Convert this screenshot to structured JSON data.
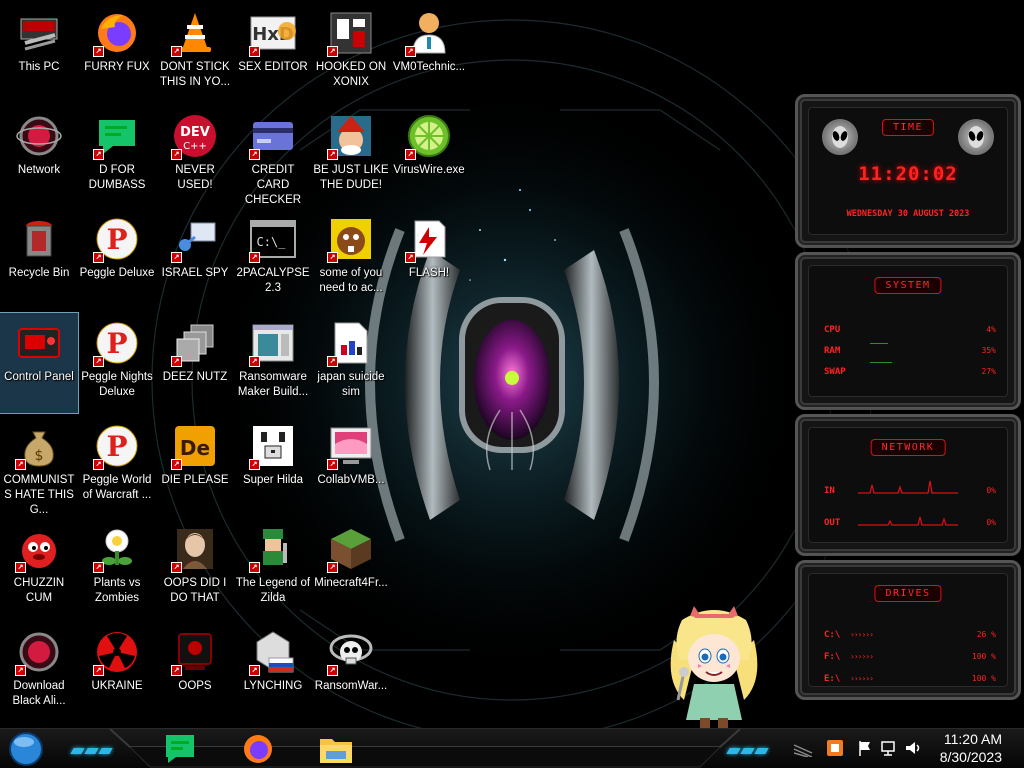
{
  "desktop": {
    "icons": [
      {
        "label": "This PC"
      },
      {
        "label": "Network"
      },
      {
        "label": "Recycle Bin"
      },
      {
        "label": "Control Panel"
      },
      {
        "label": "COMMUNISTS HATE THIS G..."
      },
      {
        "label": "CHUZZIN CUM"
      },
      {
        "label": "Download Black Ali..."
      },
      {
        "label": "FURRY FUX"
      },
      {
        "label": "D FOR DUMBASS"
      },
      {
        "label": "Peggle Deluxe"
      },
      {
        "label": "Peggle Nights Deluxe"
      },
      {
        "label": "Peggle World of Warcraft ..."
      },
      {
        "label": "Plants vs Zombies"
      },
      {
        "label": "UKRAINE"
      },
      {
        "label": "DONT STICK THIS IN YO..."
      },
      {
        "label": "NEVER USED!"
      },
      {
        "label": "ISRAEL SPY"
      },
      {
        "label": "DEEZ NUTZ"
      },
      {
        "label": "DIE PLEASE"
      },
      {
        "label": "OOPS DID I DO THAT"
      },
      {
        "label": "OOPS"
      },
      {
        "label": "SEX EDITOR"
      },
      {
        "label": "CREDIT CARD CHECKER"
      },
      {
        "label": "2PACALYPSE 2.3"
      },
      {
        "label": "Ransomware Maker Build..."
      },
      {
        "label": "Super Hilda"
      },
      {
        "label": "The Legend of Zilda"
      },
      {
        "label": "LYNCHING"
      },
      {
        "label": "HOOKED ON XONIX"
      },
      {
        "label": "BE JUST LIKE THE DUDE!"
      },
      {
        "label": "some of you need to ac..."
      },
      {
        "label": "japan suicide sim"
      },
      {
        "label": "CollabVMB..."
      },
      {
        "label": "Minecraft4Fr..."
      },
      {
        "label": "RansomWar..."
      },
      {
        "label": "VM0Technic..."
      },
      {
        "label": "VirusWire.exe"
      },
      {
        "label": "FLASH!"
      }
    ],
    "icon_glyphs": {
      "dev": "DEV",
      "dev_sub": "C++",
      "cmd": "C:\\_",
      "de": "De"
    }
  },
  "gadgets": {
    "time": {
      "title": "TIME",
      "clock": "11:20:02",
      "date": "WEDNESDAY 30 AUGUST 2023"
    },
    "system": {
      "title": "SYSTEM",
      "rows": [
        {
          "label": "CPU",
          "value": "4%"
        },
        {
          "label": "RAM",
          "value": "35%"
        },
        {
          "label": "SWAP",
          "value": "27%"
        }
      ]
    },
    "network": {
      "title": "NETWORK",
      "rows": [
        {
          "label": "IN",
          "value": "0%"
        },
        {
          "label": "OUT",
          "value": "0%"
        }
      ]
    },
    "drives": {
      "title": "DRIVES",
      "rows": [
        {
          "label": "C:\\",
          "value": "26 %"
        },
        {
          "label": "F:\\",
          "value": "100 %"
        },
        {
          "label": "E:\\",
          "value": "100 %"
        }
      ]
    }
  },
  "taskbar": {
    "time": "11:20 AM",
    "date": "8/30/2023",
    "colors": {
      "accent": "#2fb6e5",
      "gadget_red": "#ff2222"
    }
  }
}
